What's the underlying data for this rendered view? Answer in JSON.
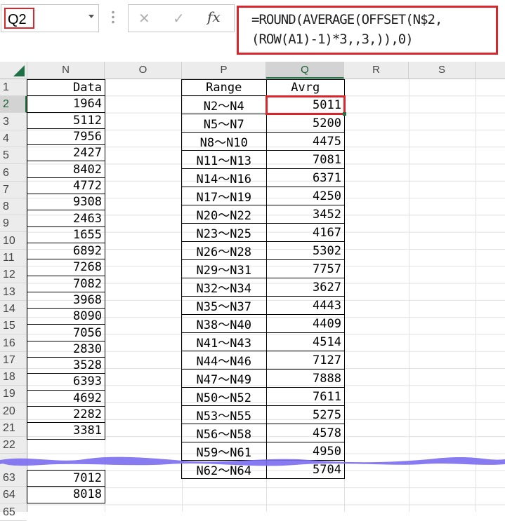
{
  "name_box": {
    "value": "Q2"
  },
  "formula_bar": {
    "cancel_glyph": "✕",
    "enter_glyph": "✓",
    "fx_label": "fx",
    "formula_line1": "=ROUND(AVERAGE(OFFSET(N$2,",
    "formula_line2": "(ROW(A1)-1)*3,,3,)),0)"
  },
  "columns": [
    "N",
    "O",
    "P",
    "Q",
    "R",
    "S"
  ],
  "rows_visible": [
    "1",
    "2",
    "3",
    "4",
    "5",
    "6",
    "7",
    "8",
    "9",
    "10",
    "11",
    "12",
    "13",
    "14",
    "15",
    "16",
    "17",
    "18",
    "19",
    "20",
    "21",
    "22",
    "63",
    "64",
    "65"
  ],
  "data_column": {
    "header": "Data",
    "values": [
      "1964",
      "5112",
      "7956",
      "2427",
      "8402",
      "4772",
      "9308",
      "2463",
      "1655",
      "6892",
      "7268",
      "7082",
      "3968",
      "8090",
      "7056",
      "2830",
      "3528",
      "6393",
      "4692",
      "2282",
      "3381"
    ],
    "tail_values": [
      "7012",
      "8018"
    ]
  },
  "range_table": {
    "header_range": "Range",
    "header_avg": "Avrg",
    "rows": [
      {
        "range": "N2～N4",
        "avg": "5011"
      },
      {
        "range": "N5～N7",
        "avg": "5200"
      },
      {
        "range": "N8～N10",
        "avg": "4475"
      },
      {
        "range": "N11～N13",
        "avg": "7081"
      },
      {
        "range": "N14～N16",
        "avg": "6371"
      },
      {
        "range": "N17～N19",
        "avg": "4250"
      },
      {
        "range": "N20～N22",
        "avg": "3452"
      },
      {
        "range": "N23～N25",
        "avg": "4167"
      },
      {
        "range": "N26～N28",
        "avg": "5302"
      },
      {
        "range": "N29～N31",
        "avg": "7757"
      },
      {
        "range": "N32～N34",
        "avg": "3627"
      },
      {
        "range": "N35～N37",
        "avg": "4443"
      },
      {
        "range": "N38～N40",
        "avg": "4409"
      },
      {
        "range": "N41～N43",
        "avg": "4514"
      },
      {
        "range": "N44～N46",
        "avg": "7127"
      },
      {
        "range": "N47～N49",
        "avg": "7888"
      },
      {
        "range": "N50～N52",
        "avg": "7611"
      },
      {
        "range": "N53～N55",
        "avg": "5275"
      },
      {
        "range": "N56～N58",
        "avg": "4578"
      },
      {
        "range": "N59～N61",
        "avg": "4950"
      },
      {
        "range": "N62～N64",
        "avg": "5704"
      }
    ]
  },
  "colors": {
    "highlight": "#d9262c",
    "excel_green": "#217346",
    "break_band": "#7b6cf0"
  }
}
